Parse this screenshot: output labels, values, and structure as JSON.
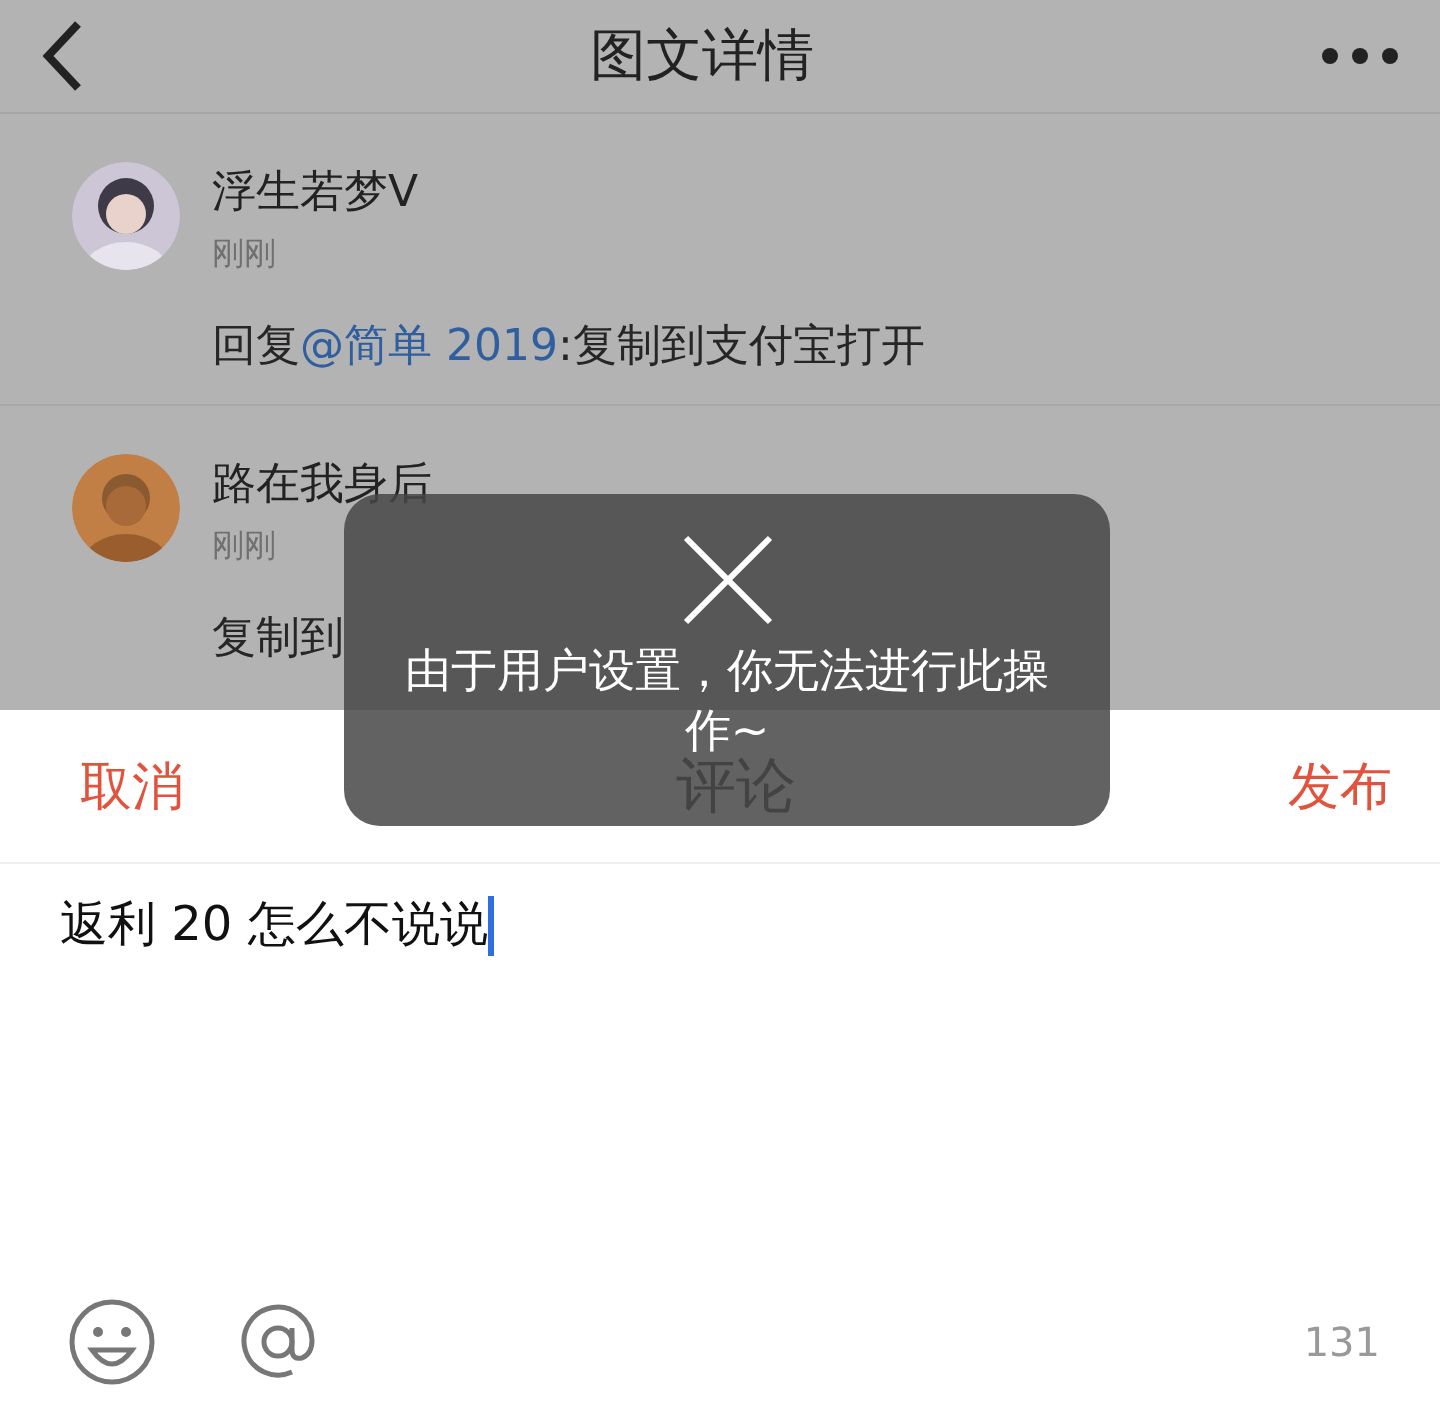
{
  "header": {
    "title": "图文详情"
  },
  "comments": [
    {
      "author": "浮生若梦V",
      "time": "刚刚",
      "reply_prefix": "回复",
      "mention": "@简单 2019",
      "text": ":复制到支付宝打开"
    },
    {
      "author": "路在我身后",
      "time": "刚刚",
      "text": "复制到"
    }
  ],
  "sheet": {
    "cancel": "取消",
    "title": "评论",
    "submit": "发布",
    "value": "返利 20 怎么不说说",
    "counter": "131"
  },
  "toast": {
    "message": "由于用户设置，你无法进行此操作~"
  }
}
